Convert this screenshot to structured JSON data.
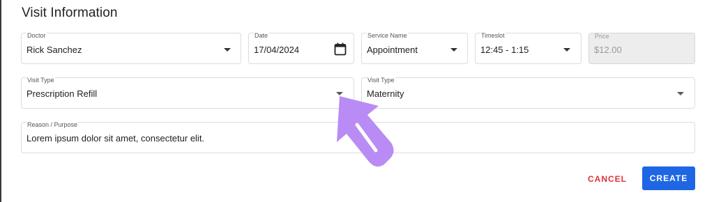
{
  "form": {
    "title": "Visit Information",
    "doctor": {
      "label": "Doctor",
      "value": "Rick Sanchez"
    },
    "date": {
      "label": "Date",
      "value": "17/04/2024"
    },
    "service": {
      "label": "Service Name",
      "value": "Appointment"
    },
    "timeslot": {
      "label": "Timeslot",
      "value": "12:45 - 1:15"
    },
    "price": {
      "label": "Price",
      "value": "$12.00"
    },
    "visit_type_1": {
      "label": "Visit Type",
      "value": "Prescription Refill"
    },
    "visit_type_2": {
      "label": "Visit Type",
      "value": "Maternity"
    },
    "reason": {
      "label": "Reason / Purpose",
      "value": "Lorem ipsum dolor sit amet, consectetur elit."
    }
  },
  "actions": {
    "cancel_label": "CANCEL",
    "create_label": "CREATE"
  },
  "colors": {
    "primary": "#1f66e5",
    "danger": "#e0313a",
    "annotation_arrow": "#b98cf5"
  },
  "icons": {
    "calendar": "calendar-icon",
    "dropdown": "chevron-down-icon",
    "annotation": "pointer-arrow-icon"
  }
}
